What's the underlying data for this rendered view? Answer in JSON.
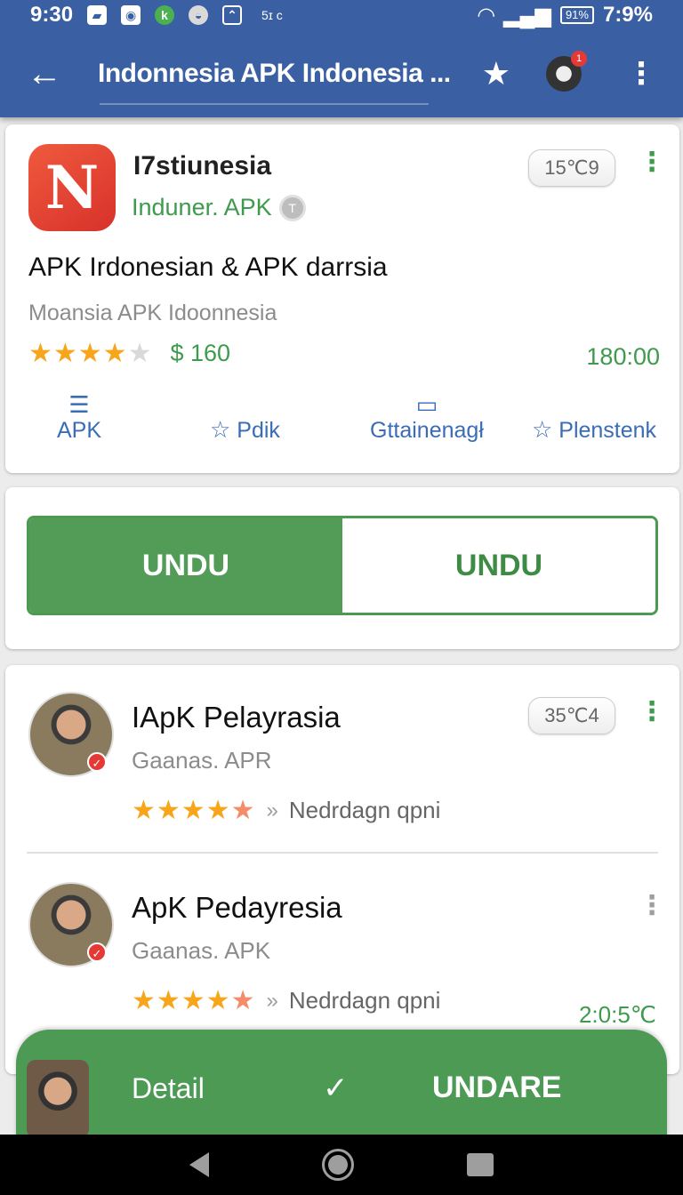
{
  "status_bar": {
    "time": "9:30",
    "extra_text": "5ɪ c",
    "battery": "91%",
    "right_text": "7:9%"
  },
  "app_bar": {
    "title": "Indonnesia APK Indonesia ...",
    "notification_count": "1"
  },
  "featured": {
    "icon_letter": "N",
    "name": "Ɩ7stiunesia",
    "developer": "Induner. APK",
    "info_badge": "T",
    "badge": "15℃9",
    "description": "APK Irdonesian & APK darrsia",
    "subtitle": "Moansia APK Idoonnesia",
    "rating": 4,
    "rating_max": 5,
    "price": "$ 160",
    "size": "180:00",
    "actions": [
      {
        "label": "APK",
        "icon": "wings-icon"
      },
      {
        "label": "Pdik",
        "icon": "star-outline-icon"
      },
      {
        "label": "Gttainenagł",
        "icon": "briefcase-icon"
      },
      {
        "label": "Plenstenk",
        "icon": "star-outline-icon"
      }
    ]
  },
  "toggle": {
    "left": "UNDU",
    "right": "UNDU"
  },
  "list": [
    {
      "name": "ΙApK Pelayrasia",
      "developer": "Gaanas. APR",
      "rating": 4.5,
      "extra": "Nedrdagn qpni",
      "badge": "35℃4",
      "size": ""
    },
    {
      "name": "ApK Pedayresia",
      "developer": "Gaanas. APK",
      "rating": 4.5,
      "extra": "Nedrdagn qpni",
      "badge": "",
      "size": "2:0:5℃"
    }
  ],
  "bottom_bar": {
    "detail": "Detail",
    "action": "UNDARE"
  },
  "colors": {
    "primary": "#3a5fa3",
    "accent_green": "#4d9a54",
    "star": "#f7a51a",
    "link_blue": "#3a6db5"
  }
}
